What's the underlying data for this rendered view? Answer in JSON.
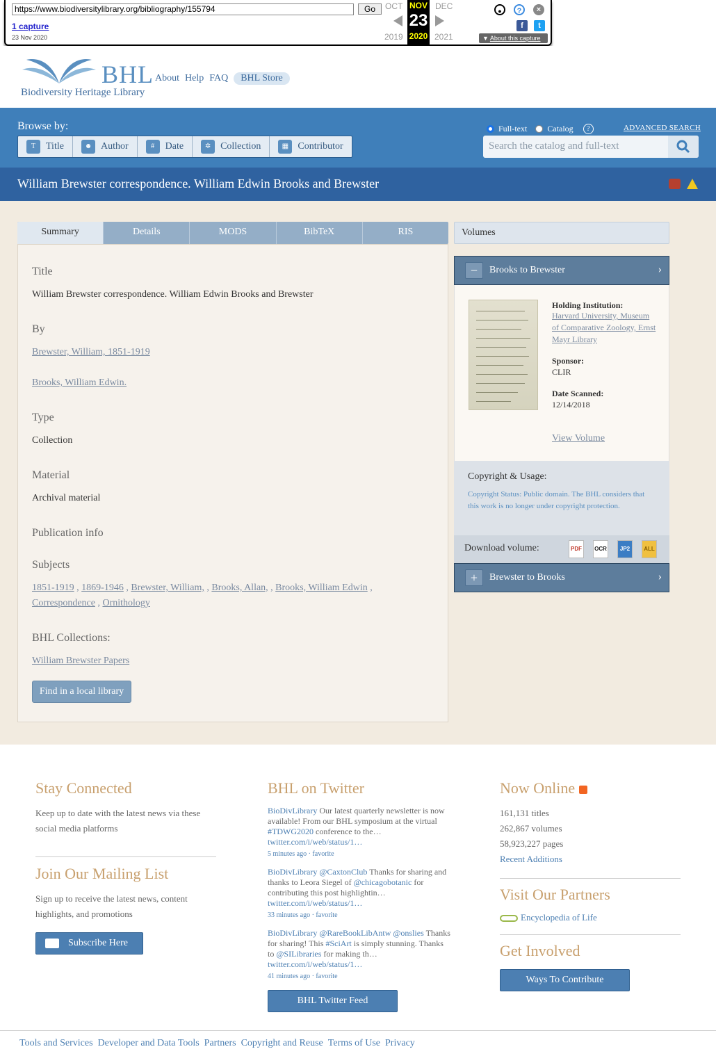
{
  "wayback": {
    "url": "https://www.biodiversitylibrary.org/bibliography/155794",
    "go": "Go",
    "captures": "1 capture",
    "capture_date": "23 Nov 2020",
    "prev_month": "OCT",
    "cur_month": "NOV",
    "next_month": "DEC",
    "day": "23",
    "prev_year": "2019",
    "cur_year": "2020",
    "next_year": "2021",
    "about": "About this capture"
  },
  "header": {
    "logo_text": "BHL",
    "logo_sub": "Biodiversity Heritage Library",
    "nav": [
      "About",
      "Help",
      "FAQ",
      "BHL Store"
    ]
  },
  "browse": {
    "label": "Browse by:",
    "buttons": [
      "Title",
      "Author",
      "Date",
      "Collection",
      "Contributor"
    ]
  },
  "search": {
    "fulltext": "Full-text",
    "catalog": "Catalog",
    "advanced": "ADVANCED SEARCH",
    "placeholder": "Search the catalog and full-text"
  },
  "page_title": "William Brewster correspondence. William Edwin Brooks and Brewster",
  "tabs": [
    "Summary",
    "Details",
    "MODS",
    "BibTeX",
    "RIS"
  ],
  "summary": {
    "title_h": "Title",
    "title": "William Brewster correspondence. William Edwin Brooks and Brewster",
    "by_h": "By",
    "authors": [
      "Brewster, William, 1851-1919",
      "Brooks, William Edwin."
    ],
    "type_h": "Type",
    "type": "Collection",
    "material_h": "Material",
    "material": "Archival material",
    "pubinfo_h": "Publication info",
    "subjects_h": "Subjects",
    "subjects_line1": [
      "1851-1919",
      "1869-1946",
      "Brewster, William,",
      "Brooks, Allan,",
      "Brooks, William Edwin"
    ],
    "subjects_line2": [
      "Correspondence",
      "Ornithology"
    ],
    "collections_h": "BHL Collections:",
    "collection": "William Brewster Papers",
    "find_btn": "Find in a local library"
  },
  "volumes": {
    "header": "Volumes",
    "vol1": "Brooks to Brewster",
    "vol2": "Brewster to Brooks",
    "holding_h": "Holding Institution:",
    "holding": "Harvard University, Museum of Comparative Zoology, Ernst Mayr Library",
    "sponsor_h": "Sponsor:",
    "sponsor": "CLIR",
    "scanned_h": "Date Scanned:",
    "scanned": "12/14/2018",
    "view": "View Volume",
    "copyright_h": "Copyright & Usage:",
    "copyright": "Copyright Status: Public domain. The BHL considers that this work is no longer under copyright protection.",
    "download": "Download volume:",
    "formats": [
      "PDF",
      "OCR",
      "JP2",
      "ALL"
    ]
  },
  "footer": {
    "stay_h": "Stay Connected",
    "stay_t": "Keep up to date with the latest news via these social media platforms",
    "mail_h": "Join Our Mailing List",
    "mail_t": "Sign up to receive the latest news, content highlights, and promotions",
    "subscribe": "Subscribe Here",
    "tw_h": "BHL on Twitter",
    "tweets": [
      {
        "a": "BioDivLibrary",
        "b": "Our latest quarterly newsletter is now available! From our BHL symposium at the virtual",
        "c": "#TDWG2020",
        "d": "conference to the…",
        "e": "twitter.com/i/web/status/1…",
        "t": "5 minutes ago · favorite"
      },
      {
        "a": "BioDivLibrary",
        "b": "@CaxtonClub",
        "c": "Thanks for sharing and thanks to Leora Siegel of",
        "d": "@chicagobotanic",
        "e": "for contributing this post highlightin…",
        "f": "twitter.com/i/web/status/1…",
        "t": "33 minutes ago · favorite"
      },
      {
        "a": "BioDivLibrary",
        "b": "@RareBookLibAntw",
        "c": "@onslies",
        "d": "Thanks for sharing! This",
        "e": "#SciArt",
        "f": "is simply stunning. Thanks to",
        "g": "@SILibraries",
        "h": "for making th…",
        "i": "twitter.com/i/web/status/1…",
        "t": "41 minutes ago · favorite"
      }
    ],
    "tw_btn": "BHL Twitter Feed",
    "online_h": "Now Online",
    "online": [
      "161,131 titles",
      "262,867 volumes",
      "58,923,227 pages"
    ],
    "recent": "Recent Additions",
    "partners_h": "Visit Our Partners",
    "partner": "Encyclopedia of Life",
    "involved_h": "Get Involved",
    "contribute": "Ways To Contribute"
  },
  "bottom_links": [
    "Tools and Services",
    "Developer and Data Tools",
    "Partners",
    "Copyright and Reuse",
    "Terms of Use",
    "Privacy"
  ]
}
